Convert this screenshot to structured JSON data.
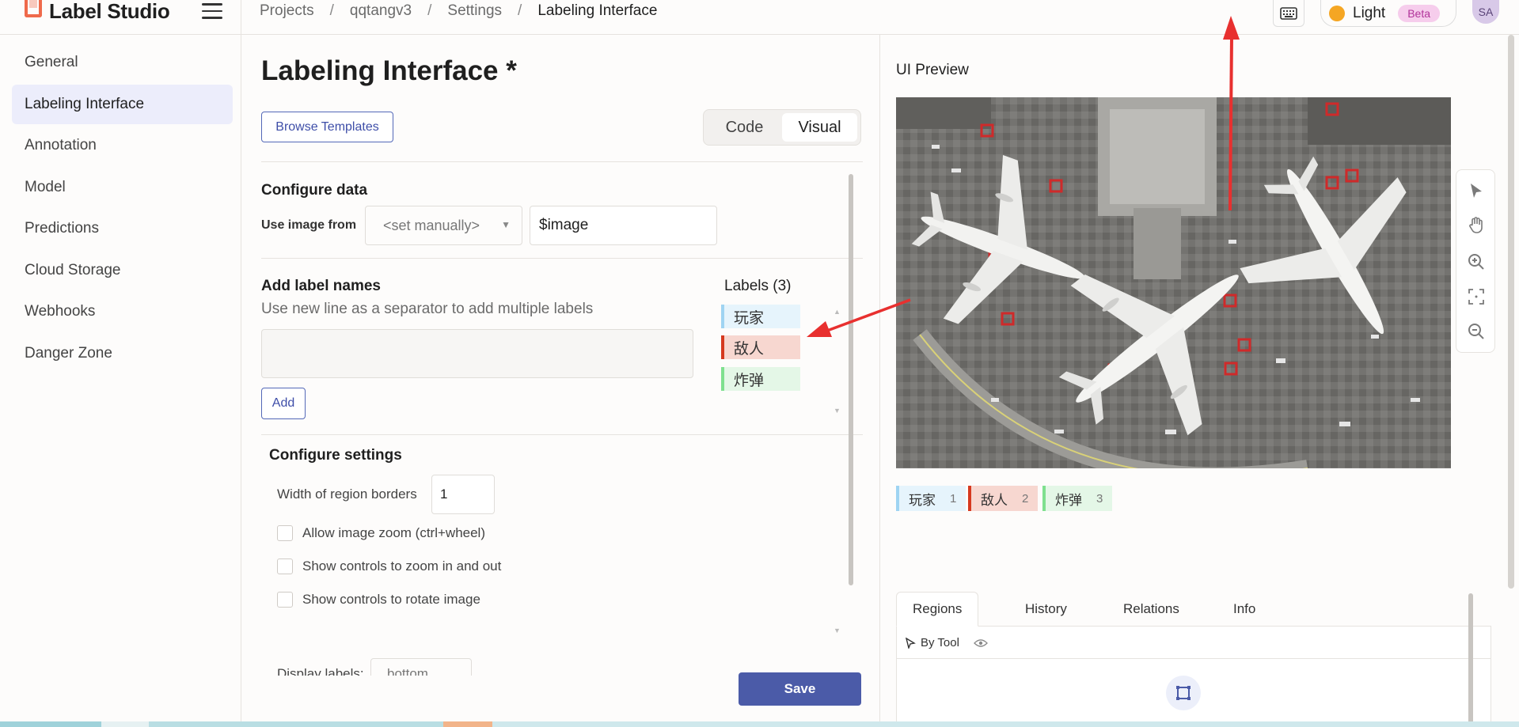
{
  "app": {
    "name": "Label Studio"
  },
  "breadcrumb": [
    "Projects",
    "qqtangv3",
    "Settings",
    "Labeling Interface"
  ],
  "header": {
    "theme_label": "Light",
    "beta_label": "Beta",
    "avatar_initials": "SA"
  },
  "sidebar": {
    "items": [
      {
        "label": "General"
      },
      {
        "label": "Labeling Interface",
        "active": true
      },
      {
        "label": "Annotation"
      },
      {
        "label": "Model"
      },
      {
        "label": "Predictions"
      },
      {
        "label": "Cloud Storage"
      },
      {
        "label": "Webhooks"
      },
      {
        "label": "Danger Zone"
      }
    ]
  },
  "config": {
    "title": "Labeling Interface *",
    "browse_templates": "Browse Templates",
    "mode": {
      "code": "Code",
      "visual": "Visual",
      "selected": "Visual"
    },
    "configure_data": {
      "title": "Configure data",
      "use_image_from": "Use image from",
      "source_select": "<set manually>",
      "source_value": "$image"
    },
    "add_labels": {
      "title": "Add label names",
      "help": "Use new line as a separator to add multiple labels",
      "textarea_value": "",
      "add_button": "Add"
    },
    "labels": {
      "title": "Labels (3)",
      "items": [
        {
          "name": "玩家",
          "color": "#9fd4f2",
          "bg": "#e6f4fc"
        },
        {
          "name": "敌人",
          "color": "#d6391f",
          "bg": "#f7d7d0"
        },
        {
          "name": "炸弹",
          "color": "#7fe08f",
          "bg": "#e4f7e7"
        }
      ]
    },
    "settings": {
      "title": "Configure settings",
      "border_width_label": "Width of region borders",
      "border_width_value": "1",
      "checkboxes": [
        "Allow image zoom (ctrl+wheel)",
        "Show controls to zoom in and out",
        "Show controls to rotate image"
      ],
      "display_labels_label": "Display labels:",
      "display_labels_value": "bottom"
    },
    "save_button": "Save"
  },
  "preview": {
    "title": "UI Preview",
    "labels": [
      {
        "name": "玩家",
        "hotkey": "1",
        "color": "#9fd4f2",
        "bg": "#e6f4fc"
      },
      {
        "name": "敌人",
        "hotkey": "2",
        "color": "#d6391f",
        "bg": "#f7d7d0"
      },
      {
        "name": "炸弹",
        "hotkey": "3",
        "color": "#7fe08f",
        "bg": "#e4f7e7"
      }
    ],
    "tabs": [
      "Regions",
      "History",
      "Relations",
      "Info"
    ],
    "active_tab": "Regions",
    "group_by": "By Tool"
  },
  "colors": {
    "accent": "#4b5ba8",
    "brand": "#ef6a4b",
    "annotation_arrow": "#e8302f"
  }
}
